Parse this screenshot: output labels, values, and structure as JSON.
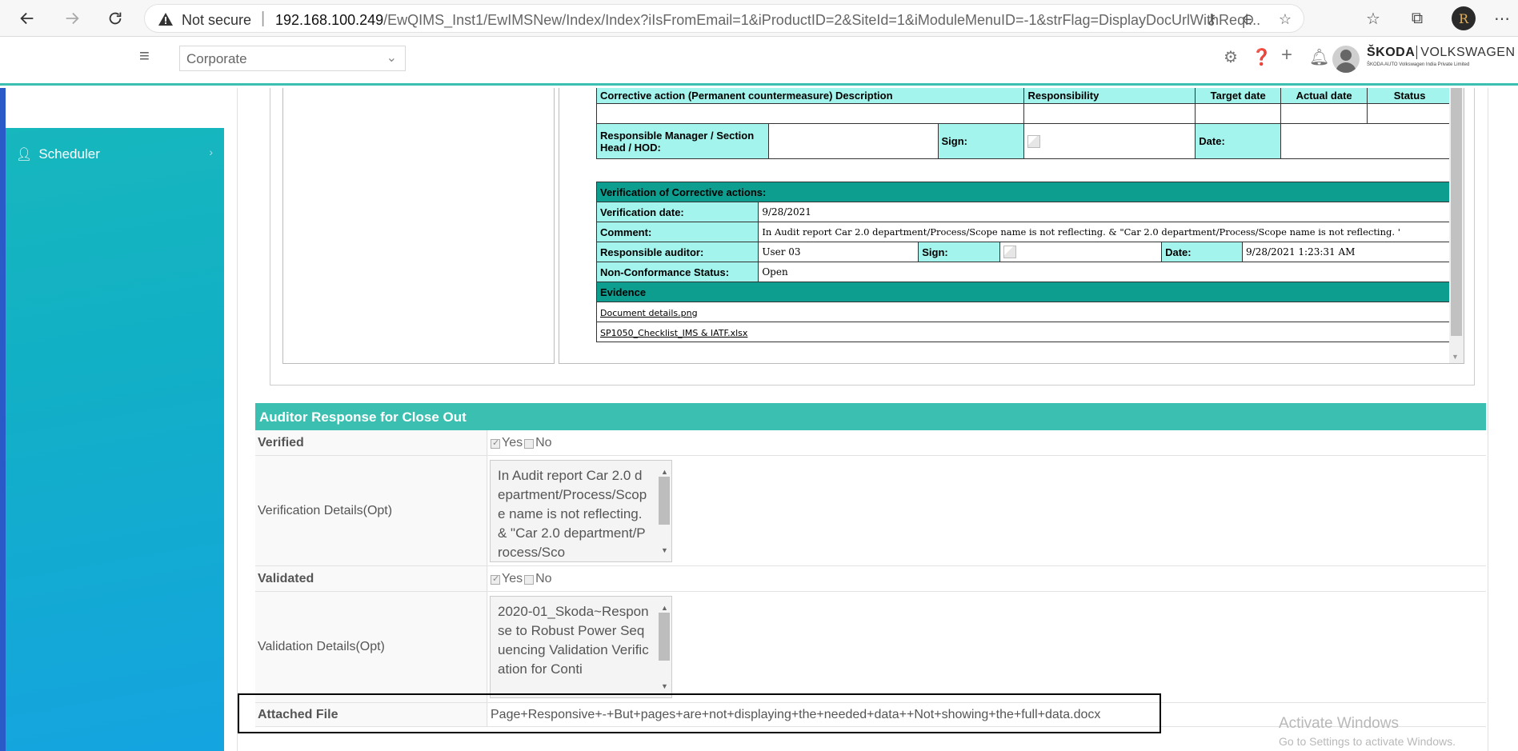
{
  "browser": {
    "not_secure": "Not secure",
    "url_host": "192.168.100.249",
    "url_path": "/EwQIMS_Inst1/EwIMSNew/Index/Index?iIsFromEmail=1&iProductID=2&SiteId=1&iModuleMenuID=-1&strFlag=DisplayDocUrlWithReql...",
    "profile_initial": "R"
  },
  "topbar": {
    "site_select": "Corporate",
    "brand_main": "ŠKODA",
    "brand_vw": "VOLKSWAGEN",
    "brand_sub": "ŠKODA AUTO Volkswagen India Private Limited"
  },
  "sidebar": {
    "items": [
      {
        "label": "Scheduler",
        "icon": "user-clock-icon"
      }
    ]
  },
  "nc_report": {
    "corrective_header": "Corrective action (Permanent countermeasure) Description",
    "col_responsibility": "Responsibility",
    "col_target_date": "Target date",
    "col_actual_date": "Actual date",
    "col_status": "Status",
    "responsible_manager_label": "Responsible Manager / Section Head / HOD:",
    "sign_label": "Sign:",
    "date_label": "Date:",
    "verification_header": "Verification of Corrective actions:",
    "verification_date_label": "Verification date:",
    "verification_date": "9/28/2021",
    "comment_label": "Comment:",
    "comment": "In Audit report Car 2.0 department/Process/Scope name is not reflecting. & \"Car 2.0 department/Process/Scope name is not reflecting. '",
    "responsible_auditor_label": "Responsible auditor:",
    "responsible_auditor": "User 03",
    "auditor_sign_label": "Sign:",
    "auditor_date_label": "Date:",
    "auditor_date": "9/28/2021 1:23:31 AM",
    "nc_status_label": "Non-Conformance Status:",
    "nc_status": "Open",
    "evidence_header": "Evidence",
    "evidence_files": [
      "Document details.png",
      "SP1050_Checklist_IMS & IATF.xlsx"
    ]
  },
  "auditor_response": {
    "title": "Auditor Response for Close Out",
    "verified_label": "Verified",
    "yes": "Yes",
    "no": "No",
    "verification_details_label": "Verification Details(Opt)",
    "verification_details": "In Audit report Car 2.0 department/Process/Scope name is not reflecting. & \"Car 2.0 department/Process/Sco",
    "validated_label": "Validated",
    "validation_details_label": "Validation Details(Opt)",
    "validation_details": "2020-01_Skoda~Response to Robust Power Sequencing Validation Verification for Conti",
    "attached_file_label": "Attached File",
    "attached_file": "Page+Responsive+-+But+pages+are+not+displaying+the+needed+data++Not+showing+the+full+data.docx"
  },
  "watermark": {
    "line1": "Activate Windows",
    "line2": "Go to Settings to activate Windows."
  }
}
